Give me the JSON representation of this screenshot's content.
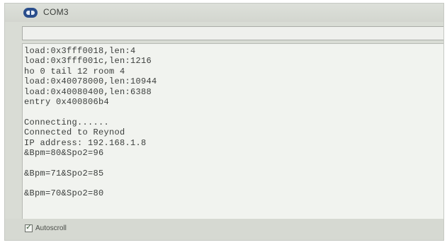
{
  "window": {
    "title": "COM3",
    "icon": "serial-monitor-icon"
  },
  "send_input": {
    "value": ""
  },
  "output": {
    "lines": [
      "load:0x3fff0018,len:4",
      "load:0x3fff001c,len:1216",
      "ho 0 tail 12 room 4",
      "load:0x40078000,len:10944",
      "load:0x40080400,len:6388",
      "entry 0x400806b4",
      "",
      "Connecting......",
      "Connected to Reynod",
      "IP address: 192.168.1.8",
      "&Bpm=80&Spo2=96",
      "",
      "&Bpm=71&Spo2=85",
      "",
      "&Bpm=70&Spo2=80"
    ]
  },
  "footer": {
    "autoscroll_label": "Autoscroll",
    "autoscroll_checked": true,
    "check_glyph": "✓"
  }
}
